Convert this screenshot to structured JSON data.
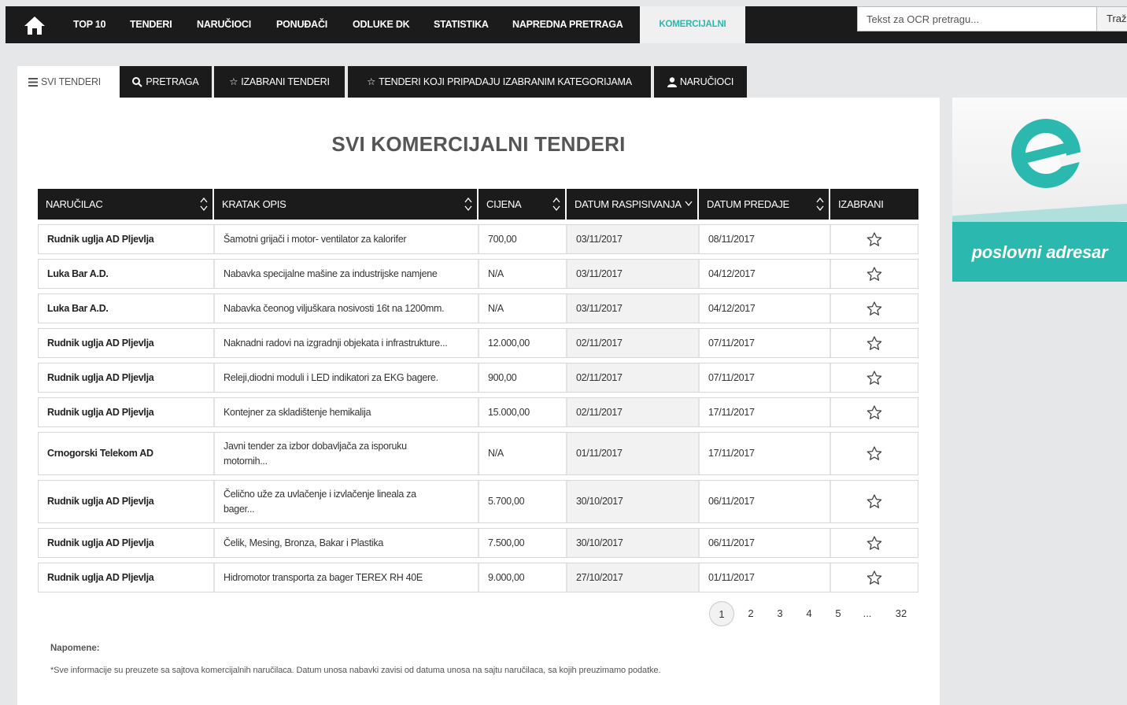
{
  "nav": {
    "items": [
      {
        "label": "TOP 10"
      },
      {
        "label": "TENDERI"
      },
      {
        "label": "NARUČIOCI"
      },
      {
        "label": "PONUĐAČI"
      },
      {
        "label": "ODLUKE DK"
      },
      {
        "label": "STATISTIKA"
      },
      {
        "label": "NAPREDNA PRETRAGA"
      },
      {
        "label": "KOMERCIJALNI"
      }
    ],
    "active": "KOMERCIJALNI",
    "search_placeholder": "Tekst za OCR pretragu...",
    "search_button": "Traži",
    "accent_color": "#2bb8ae"
  },
  "tabs": [
    {
      "label": "SVI TENDERI",
      "icon": "list-icon"
    },
    {
      "label": "PRETRAGA",
      "icon": "search-icon"
    },
    {
      "label": "IZABRANI TENDERI",
      "icon": "star-icon"
    },
    {
      "label": "TENDERI KOJI PRIPADAJU IZABRANIM KATEGORIJAMA",
      "icon": "star-icon"
    },
    {
      "label": "NARUČIOCI",
      "icon": "user-icon"
    }
  ],
  "page_title": "SVI KOMERCIJALNI TENDERI",
  "table": {
    "headers": [
      "NARUČILAC",
      "KRATAK OPIS",
      "CIJENA",
      "DATUM RASPISIVANJA",
      "DATUM PREDAJE",
      "IZABRANI"
    ],
    "rows": [
      {
        "buyer": "Rudnik uglja AD Pljevlja",
        "desc": "Šamotni grijači i motor- ventilator za kalorifer",
        "price": "700,00",
        "published": "03/11/2017",
        "deadline": "08/11/2017"
      },
      {
        "buyer": "Luka Bar A.D.",
        "desc": "Nabavka specijalne mašine za industrijske namjene",
        "price": "N/A",
        "published": "03/11/2017",
        "deadline": "04/12/2017"
      },
      {
        "buyer": "Luka Bar A.D.",
        "desc": "Nabavka čeonog viljuškara nosivosti 16t na 1200mm.",
        "price": "N/A",
        "published": "03/11/2017",
        "deadline": "04/12/2017"
      },
      {
        "buyer": "Rudnik uglja AD Pljevlja",
        "desc": "Naknadni radovi na izgradnji objekata i infrastrukture...",
        "price": "12.000,00",
        "published": "02/11/2017",
        "deadline": "07/11/2017"
      },
      {
        "buyer": "Rudnik uglja AD Pljevlja",
        "desc": "Releji,diodni moduli i LED indikatori za EKG bagere.",
        "price": "900,00",
        "published": "02/11/2017",
        "deadline": "07/11/2017"
      },
      {
        "buyer": "Rudnik uglja AD Pljevlja",
        "desc": "Kontejner za skladištenje hemikalija",
        "price": "15.000,00",
        "published": "02/11/2017",
        "deadline": "17/11/2017"
      },
      {
        "buyer": "Crnogorski Telekom AD",
        "desc": "Javni tender za izbor dobavljača za isporuku motornih...",
        "price": "N/A",
        "published": "01/11/2017",
        "deadline": "17/11/2017"
      },
      {
        "buyer": "Rudnik uglja AD Pljevlja",
        "desc": "Čelično uže za uvlačenje i izvlačenje lineala za bager...",
        "price": "5.700,00",
        "published": "30/10/2017",
        "deadline": "06/11/2017"
      },
      {
        "buyer": "Rudnik uglja AD Pljevlja",
        "desc": "Čelik, Mesing, Bronza, Bakar i Plastika",
        "price": "7.500,00",
        "published": "30/10/2017",
        "deadline": "06/11/2017"
      },
      {
        "buyer": "Rudnik uglja AD Pljevlja",
        "desc": "Hidromotor transporta za bager TEREX RH 40E",
        "price": "9.000,00",
        "published": "27/10/2017",
        "deadline": "01/11/2017"
      }
    ]
  },
  "pagination": {
    "pages": [
      "1",
      "2",
      "3",
      "4",
      "5",
      "...",
      "32"
    ],
    "current": "1"
  },
  "notes": {
    "title": "Napomene:",
    "text": "*Sve informacije su preuzete sa sajtova komercijalnih naručilaca. Datum unosa nabavki zavisi od datuma unosa na sajtu naručilaca, sa kojih preuzimamo podatke."
  },
  "ad": {
    "text": "poslovni adresar",
    "logo": "e-logo-icon",
    "color": "#2bb8ae"
  }
}
